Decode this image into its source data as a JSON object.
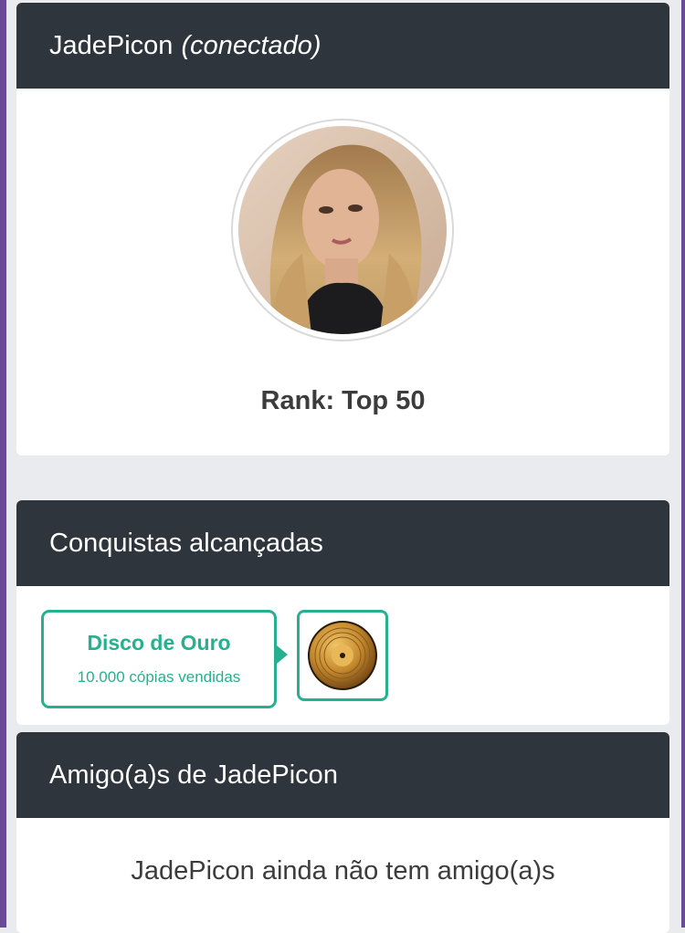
{
  "colors": {
    "header_bg": "#2e353c",
    "accent": "#26b08f",
    "page_bg": "#e9ebee",
    "frame": "#6a4a97"
  },
  "profile": {
    "username": "JadePicon",
    "status": "(conectado)",
    "rank": "Rank: Top 50"
  },
  "achievements": {
    "title": "Conquistas alcançadas",
    "items": [
      {
        "name": "Disco de Ouro",
        "description": "10.000 cópias vendidas",
        "icon": "gold-record-icon"
      }
    ]
  },
  "friends": {
    "title": "Amigo(a)s de JadePicon",
    "empty_message": "JadePicon ainda não tem amigo(a)s"
  }
}
